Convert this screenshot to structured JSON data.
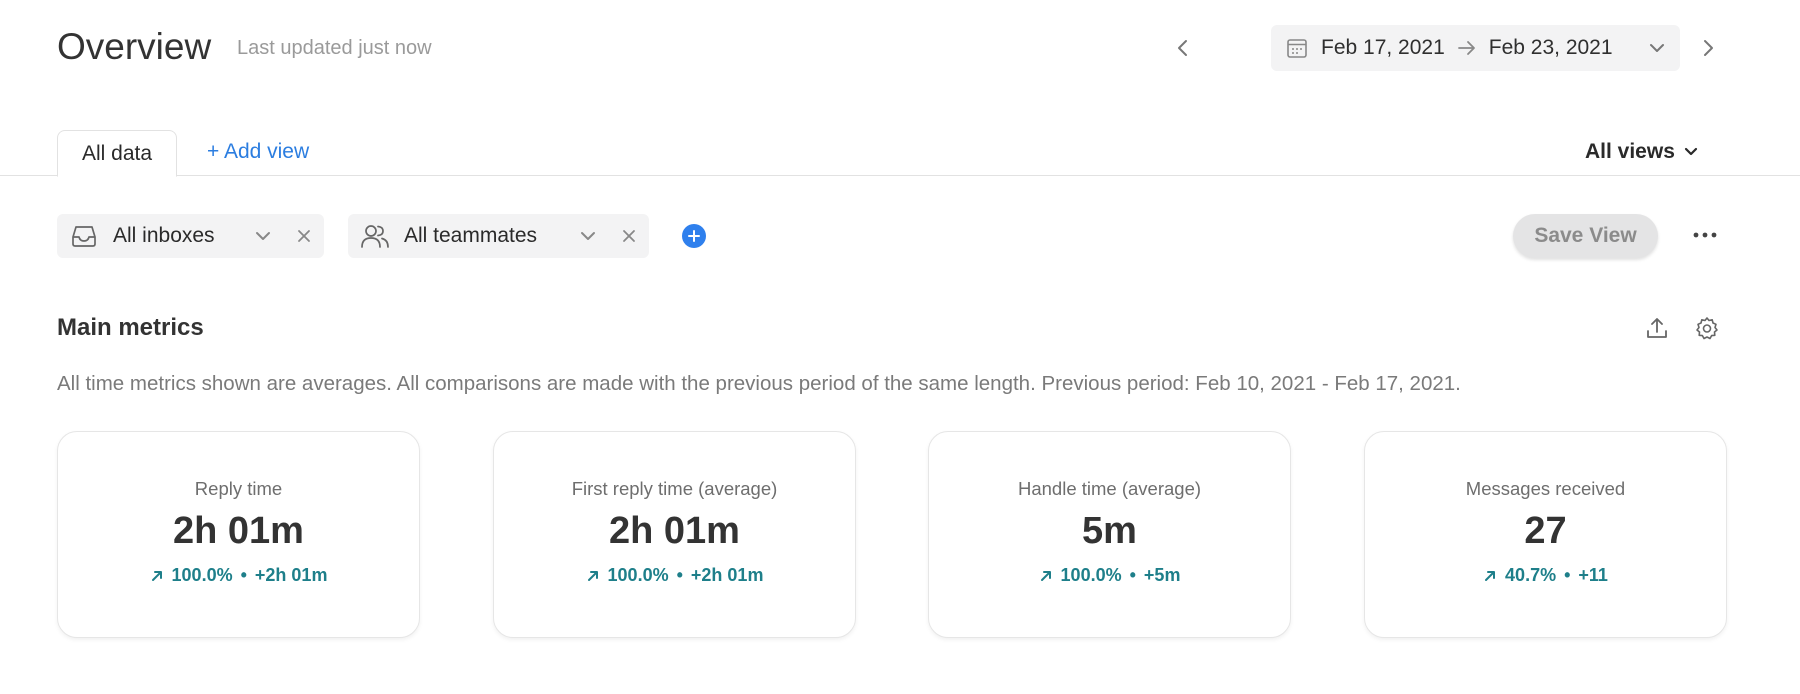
{
  "header": {
    "title": "Overview",
    "subtitle": "Last updated just now",
    "date_start": "Feb 17, 2021",
    "date_end": "Feb 23, 2021"
  },
  "tabs": {
    "active_label": "All data",
    "add_view_label": "+ Add view",
    "all_views_label": "All views"
  },
  "filters": {
    "inboxes_label": "All inboxes",
    "teammates_label": "All teammates",
    "save_view_label": "Save View"
  },
  "section": {
    "title": "Main metrics",
    "description": "All time metrics shown are averages. All comparisons are made with the previous period of the same length. Previous period: Feb 10, 2021 - Feb 17, 2021."
  },
  "metrics": [
    {
      "title": "Reply time",
      "value": "2h 01m",
      "percent": "100.0%",
      "sep": "•",
      "delta": "+2h 01m"
    },
    {
      "title": "First reply time (average)",
      "value": "2h 01m",
      "percent": "100.0%",
      "sep": "•",
      "delta": "+2h 01m"
    },
    {
      "title": "Handle time (average)",
      "value": "5m",
      "percent": "100.0%",
      "sep": "•",
      "delta": "+5m"
    },
    {
      "title": "Messages received",
      "value": "27",
      "percent": "40.7%",
      "sep": "•",
      "delta": "+11"
    }
  ],
  "icons": {
    "prev": "chevron-left-icon",
    "next": "chevron-right-icon",
    "calendar": "calendar-icon",
    "arrow": "arrow-right-icon",
    "dropdown": "chevron-down-icon",
    "inbox": "inbox-icon",
    "teammates": "users-icon",
    "clear": "close-icon",
    "add": "plus-circle-icon",
    "more": "more-horizontal-icon",
    "export": "upload-icon",
    "settings": "gear-icon",
    "trend": "arrow-up-right-icon"
  },
  "colors": {
    "accent": "#2f80ed",
    "link": "#2b7de0",
    "positive": "#1e7f8a",
    "chip_bg": "#f3f3f4"
  }
}
